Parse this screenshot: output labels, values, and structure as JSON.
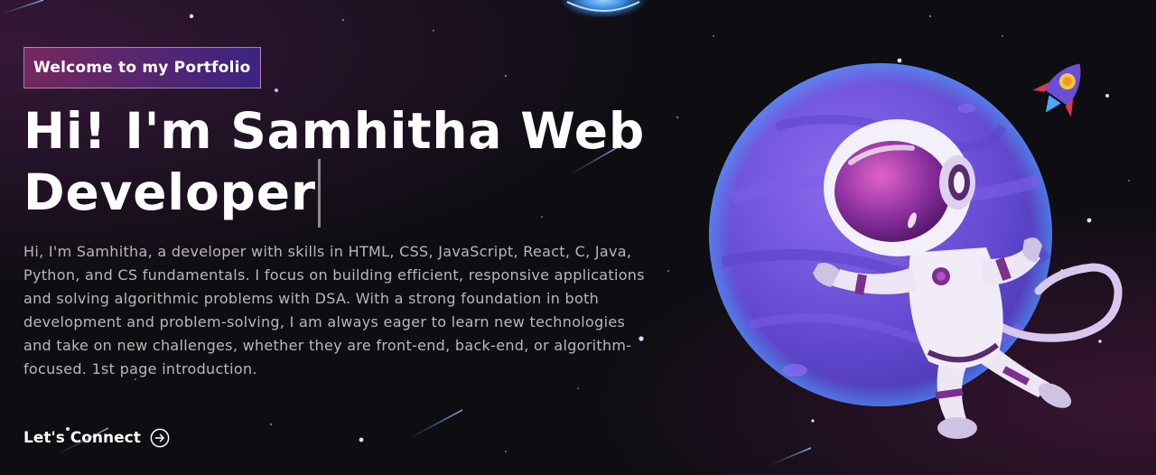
{
  "hero": {
    "tagline": "Welcome to my Portfolio",
    "headline_line1": "Hi! I'm Samhitha Web",
    "headline_line2": "Developer",
    "intro": "Hi, I'm Samhitha, a developer with skills in HTML, CSS, JavaScript, React, C, Java, Python, and CS fundamentals. I focus on building efficient, responsive applications and solving algorithmic problems with DSA. With a strong foundation in both development and problem-solving, I am always eager to learn new technologies and take on new challenges, whether they are front-end, back-end, or algorithm-focused. 1st page introduction.",
    "cta_label": "Let's Connect",
    "cta_icon": "arrow-right-circle-icon"
  },
  "illustration": {
    "subject": "astronaut-planet-illustration",
    "rocket": "rocket-icon",
    "planet": "planet-illustration"
  },
  "colors": {
    "background": "#0e0d12",
    "tagline_gradient_start": "#aa367c",
    "tagline_gradient_end": "#4a2fbd",
    "text_primary": "#ffffff",
    "text_secondary": "#b8b8b8",
    "planet": "#6a4fd6",
    "accent_glow": "#4aa8ff"
  }
}
